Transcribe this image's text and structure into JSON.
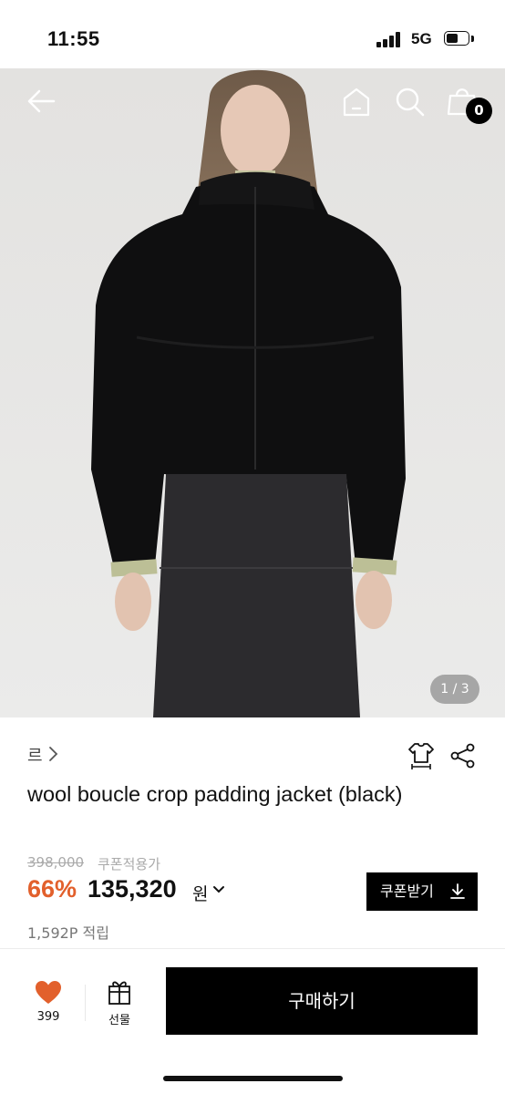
{
  "status_bar": {
    "time": "11:55",
    "network": "5G",
    "icons": [
      "signal-icon",
      "battery-icon"
    ]
  },
  "hero": {
    "page_indicator": "1 / 3",
    "current_image": 1,
    "total_images": 3,
    "cart_count": "0",
    "icons": [
      "back-arrow-icon",
      "home-icon",
      "search-icon",
      "cart-icon"
    ]
  },
  "product": {
    "brand": "르",
    "title": "wool boucle crop padding jacket (black)",
    "original_price": "398,000",
    "coupon_note": "쿠폰적용가",
    "discount": "66%",
    "sale_price": "135,320",
    "currency": "원",
    "coupon_button": "쿠폰받기",
    "points": "1,592P 적립",
    "icons": [
      "size-guide-icon",
      "share-icon",
      "chevron-right-icon",
      "chevron-down-icon",
      "download-icon"
    ]
  },
  "bottom_bar": {
    "like_count": "399",
    "gift_label": "선물",
    "buy_button": "구매하기",
    "icons": [
      "heart-icon",
      "gift-icon"
    ]
  },
  "colors": {
    "accent": "#e2602c",
    "heart": "#e2602c",
    "primary_button": "#000000",
    "background": "#ffffff"
  }
}
